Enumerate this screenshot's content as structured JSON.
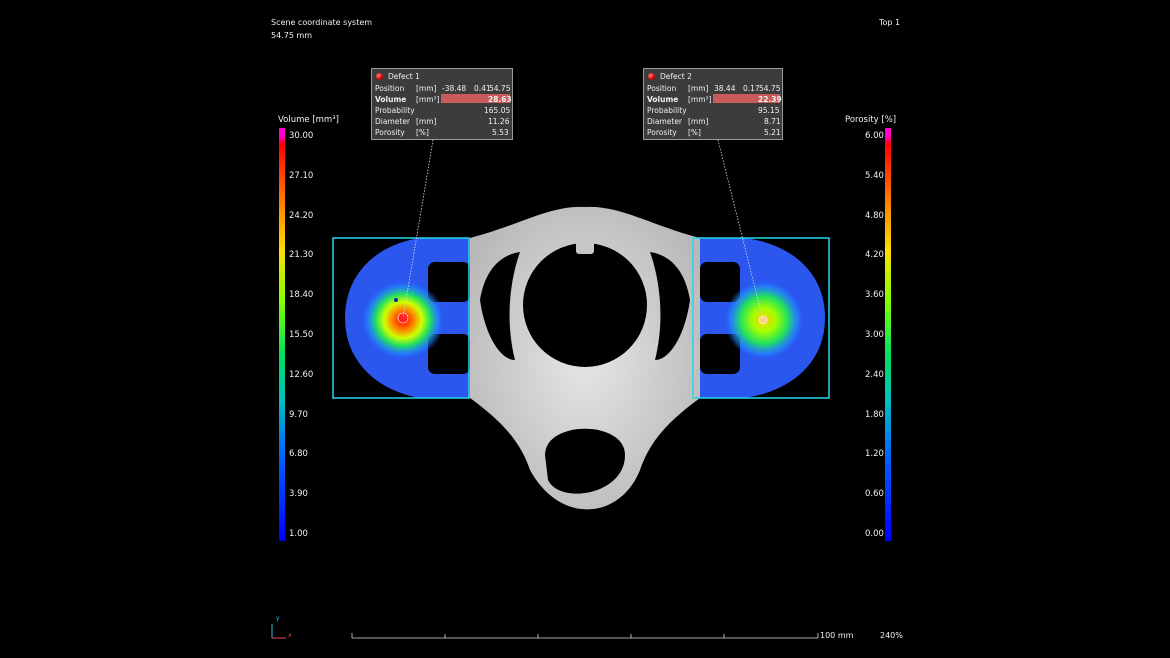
{
  "header": {
    "coord_system": "Scene coordinate system",
    "depth": "54.75 mm",
    "view": "Top 1"
  },
  "left_colorbar": {
    "title": "Volume [mm³]",
    "ticks": [
      "30.00",
      "27.10",
      "24.20",
      "21.30",
      "18.40",
      "15.50",
      "12.60",
      "9.70",
      "6.80",
      "3.90",
      "1.00"
    ]
  },
  "right_colorbar": {
    "title": "Porosity [%]",
    "ticks": [
      "6.00",
      "5.40",
      "4.80",
      "4.20",
      "3.60",
      "3.00",
      "2.40",
      "1.80",
      "1.20",
      "0.60",
      "0.00"
    ]
  },
  "defects": [
    {
      "name": "Defect 1",
      "position_label": "Position",
      "position_unit": "[mm]",
      "position": [
        "-38.48",
        "0.41",
        "54.75"
      ],
      "volume_label": "Volume",
      "volume_unit": "[mm³]",
      "volume": "28.63",
      "probability_label": "Probability",
      "probability": "165.05",
      "diameter_label": "Diameter",
      "diameter_unit": "[mm]",
      "diameter": "11.26",
      "porosity_label": "Porosity",
      "porosity_unit": "[%]",
      "porosity": "5.53"
    },
    {
      "name": "Defect 2",
      "position_label": "Position",
      "position_unit": "[mm]",
      "position": [
        "38.44",
        "0.17",
        "54.75"
      ],
      "volume_label": "Volume",
      "volume_unit": "[mm³]",
      "volume": "22.39",
      "probability_label": "Probability",
      "probability": "95.15",
      "diameter_label": "Diameter",
      "diameter_unit": "[mm]",
      "diameter": "8.71",
      "porosity_label": "Porosity",
      "porosity_unit": "[%]",
      "porosity": "5.21"
    }
  ],
  "footer": {
    "scale_label": "100 mm",
    "zoom": "240%",
    "axis_y": "y",
    "axis_x": "x"
  },
  "colors": {
    "roi_box": "#22d8e8",
    "highlight": "#c85a5a",
    "part_gray": "#cfcfcf"
  }
}
